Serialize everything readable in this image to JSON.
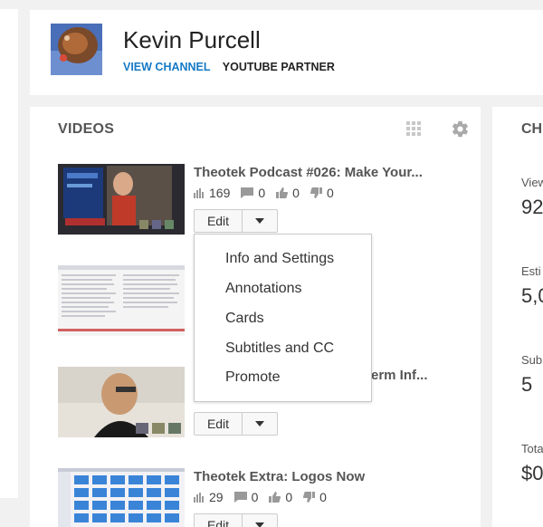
{
  "header": {
    "channel_name": "Kevin Purcell",
    "view_channel": "VIEW CHANNEL",
    "partner_label": "YOUTUBE PARTNER"
  },
  "videos": {
    "title": "VIDEOS",
    "items": [
      {
        "title": "Theotek Podcast #026: Make Your...",
        "views": "169",
        "comments": "0",
        "likes": "0",
        "dislikes": "0",
        "edit_label": "Edit"
      },
      {
        "title": "",
        "edit_label": ""
      },
      {
        "title": "erm Inf...",
        "edit_label": "Edit"
      },
      {
        "title": "Theotek Extra: Logos Now",
        "views": "29",
        "comments": "0",
        "likes": "0",
        "dislikes": "0",
        "edit_label": "Edit"
      }
    ]
  },
  "dropdown": {
    "items": [
      "Info and Settings",
      "Annotations",
      "Cards",
      "Subtitles and CC",
      "Promote"
    ]
  },
  "channel_panel": {
    "title": "CH",
    "stats": [
      {
        "label": "View",
        "value": "92"
      },
      {
        "label": "Esti",
        "value": "5,0"
      },
      {
        "label": "Sub",
        "value": "5"
      },
      {
        "label": "Tota",
        "value": "$0"
      }
    ]
  },
  "colors": {
    "link": "#167ac6",
    "background": "#f1f1f1"
  },
  "icons": [
    "grid-icon",
    "gear-icon",
    "views-icon",
    "comments-icon",
    "likes-icon",
    "dislikes-icon",
    "chevron-down-icon"
  ]
}
